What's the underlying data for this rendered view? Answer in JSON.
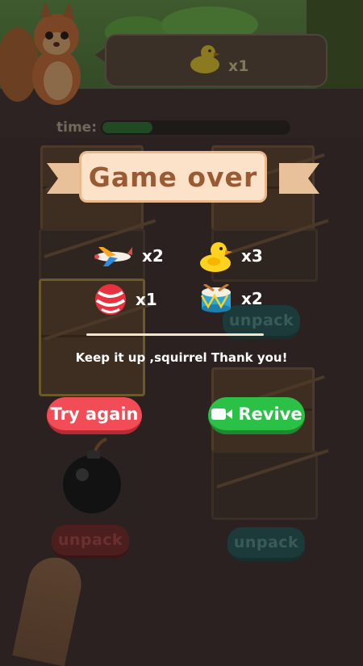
{
  "order_bubble": {
    "item_icon": "rubber-duck-icon",
    "count_label": "x1"
  },
  "timer": {
    "label": "time:",
    "progress": 0.27
  },
  "dialog": {
    "title": "Game over",
    "rewards": [
      {
        "icon": "toy-airplane-icon",
        "count": "x2"
      },
      {
        "icon": "rubber-duck-icon",
        "count": "x3"
      },
      {
        "icon": "candy-ball-icon",
        "count": "x1"
      },
      {
        "icon": "toy-drum-icon",
        "count": "x2"
      }
    ],
    "message": "Keep it up ,squirrel Thank you!",
    "try_again_label": "Try again",
    "revive_label": "Revive"
  },
  "board": {
    "unpack_labels": [
      "unpack",
      "unpack",
      "unpack"
    ]
  },
  "colors": {
    "try_again": "#f24d57",
    "revive": "#2bc146",
    "banner": "#fbe2c8",
    "title_text": "#9a5a34"
  }
}
